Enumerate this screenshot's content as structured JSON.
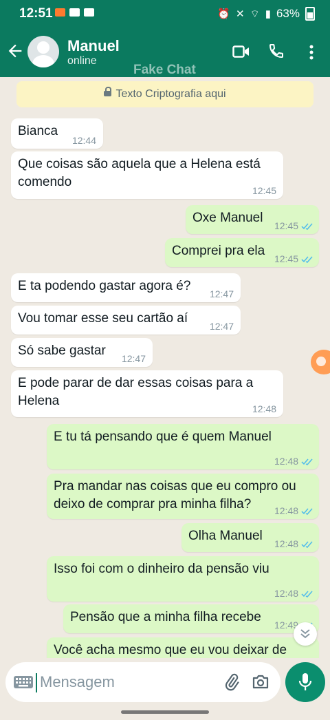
{
  "status_bar": {
    "time": "12:51",
    "battery": "63%"
  },
  "header": {
    "name": "Manuel",
    "status": "online",
    "watermark": "Fake Chat"
  },
  "encryption": {
    "text": "Texto Criptografia aqui"
  },
  "messages": [
    {
      "dir": "in",
      "text": "Bianca",
      "time": "12:44"
    },
    {
      "dir": "in",
      "text": "Que coisas são aquela que a Helena está comendo",
      "time": "12:45"
    },
    {
      "dir": "out",
      "text": "Oxe Manuel",
      "time": "12:45"
    },
    {
      "dir": "out",
      "text": "Comprei pra ela",
      "time": "12:45"
    },
    {
      "dir": "in",
      "text": "E ta podendo gastar agora é?",
      "time": "12:47"
    },
    {
      "dir": "in",
      "text": "Vou tomar esse seu cartão aí",
      "time": "12:47"
    },
    {
      "dir": "in",
      "text": "Só sabe gastar",
      "time": "12:47"
    },
    {
      "dir": "in",
      "text": "E pode parar de dar essas coisas para a Helena",
      "time": "12:48"
    },
    {
      "dir": "out",
      "text": "E tu tá pensando que é quem Manuel",
      "time": "12:48"
    },
    {
      "dir": "out",
      "text": "Pra mandar nas coisas que eu compro ou deixo de comprar pra minha filha?",
      "time": "12:48"
    },
    {
      "dir": "out",
      "text": "Olha Manuel",
      "time": "12:48"
    },
    {
      "dir": "out",
      "text": "Isso foi com o dinheiro da pensão viu",
      "time": "12:48"
    },
    {
      "dir": "out",
      "text": "Pensão que a minha filha recebe",
      "time": "12:49"
    },
    {
      "dir": "out",
      "text": "Você acha mesmo que eu vou deixar de",
      "time": ""
    }
  ],
  "input": {
    "placeholder": "Mensagem"
  },
  "colors": {
    "header": "#0b7a5f",
    "outgoing": "#dcf8c6",
    "incoming": "#ffffff",
    "read_ticks": "#53bdeb",
    "mic_button": "#0b8e6e"
  }
}
